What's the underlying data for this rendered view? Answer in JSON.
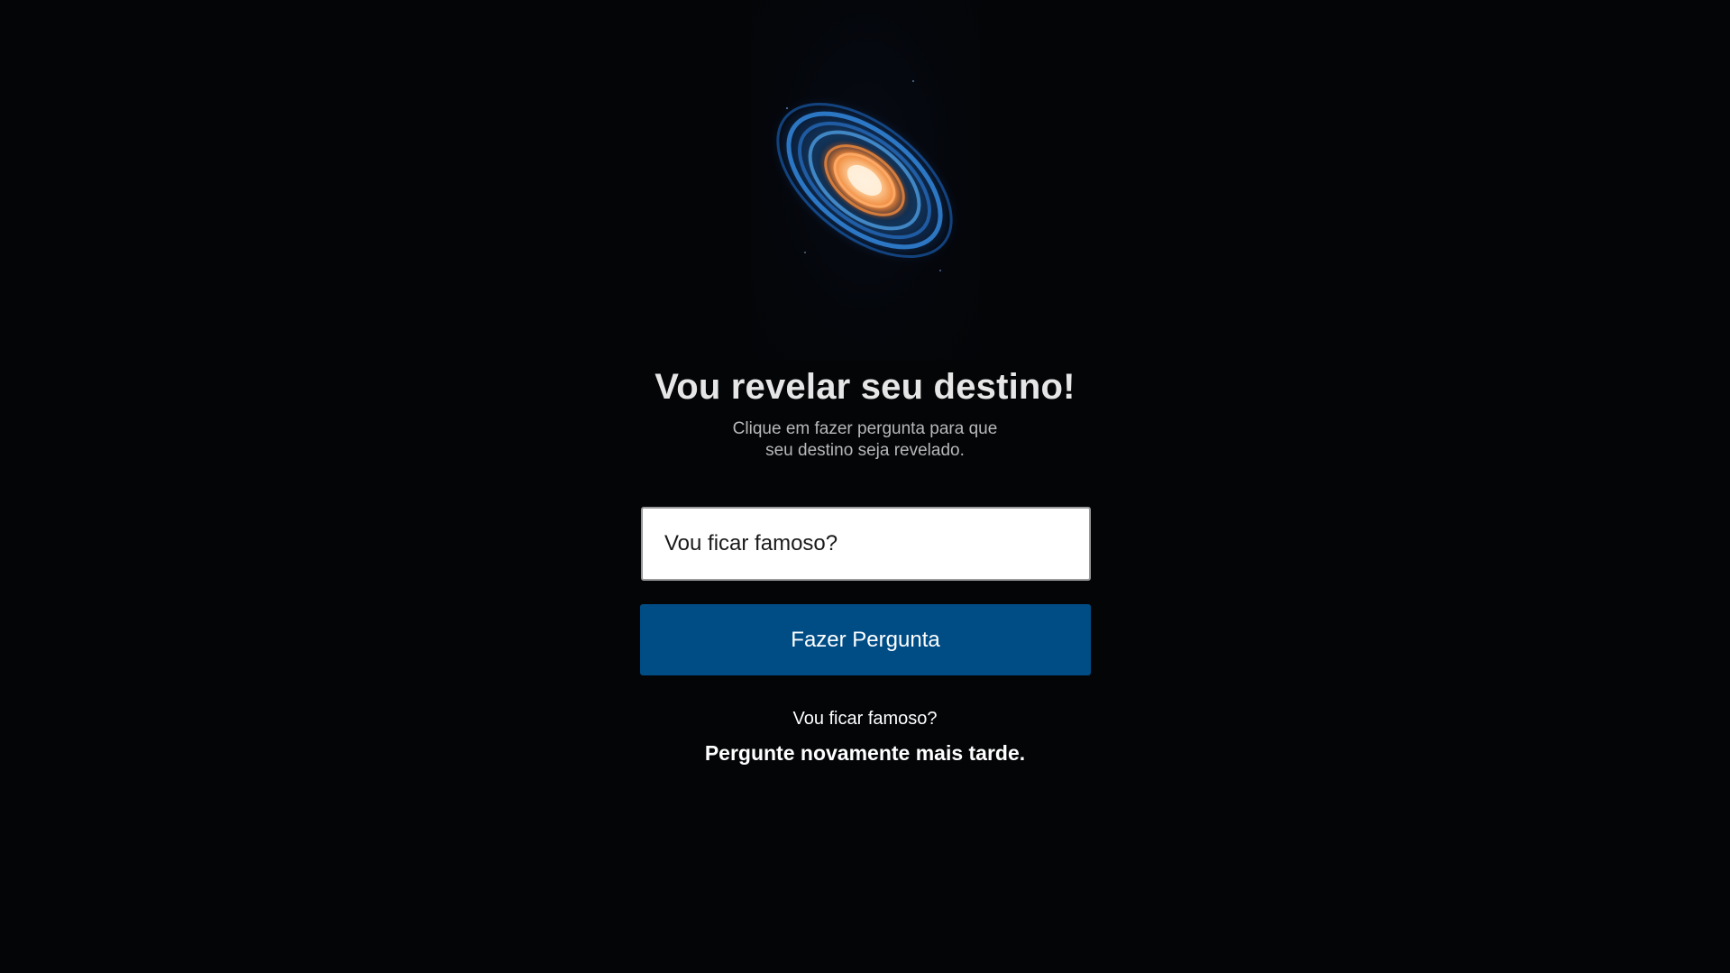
{
  "hero": {
    "image_name": "galaxy-icon"
  },
  "header": {
    "title": "Vou revelar seu destino!",
    "subtitle_line1": "Clique em fazer pergunta para que",
    "subtitle_line2": "seu destino seja revelado."
  },
  "form": {
    "question_value": "Vou ficar famoso?",
    "button_label": "Fazer Pergunta"
  },
  "result": {
    "question": "Vou ficar famoso?",
    "answer": "Pergunte novamente mais tarde."
  },
  "colors": {
    "background": "#030507",
    "button": "#004d86",
    "title": "#e6e6e6"
  }
}
